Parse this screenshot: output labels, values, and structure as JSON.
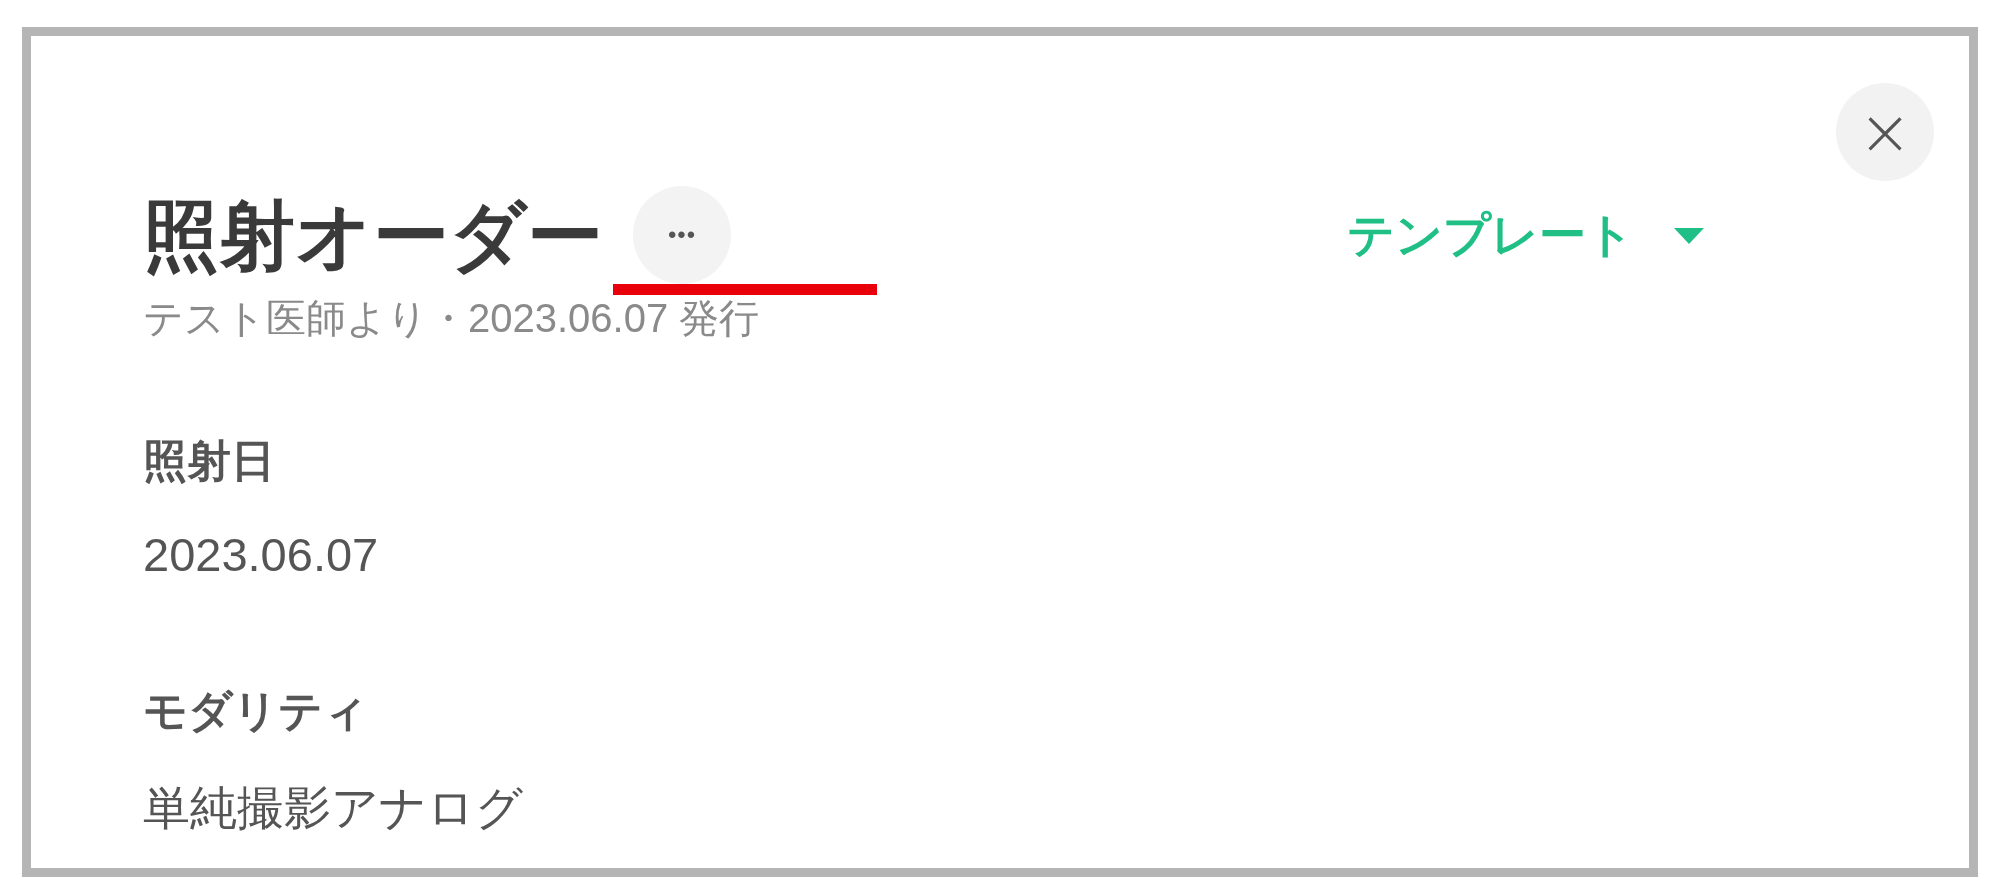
{
  "dialog": {
    "title": "照射オーダー",
    "more_button": "•••",
    "subtitle": "テスト医師より・2023.06.07 発行",
    "template_button": "テンプレート",
    "close_button": "×",
    "fields": [
      {
        "label": "照射日",
        "value": "2023.06.07"
      },
      {
        "label": "モダリティ",
        "value": "単純撮影アナログ"
      }
    ]
  }
}
